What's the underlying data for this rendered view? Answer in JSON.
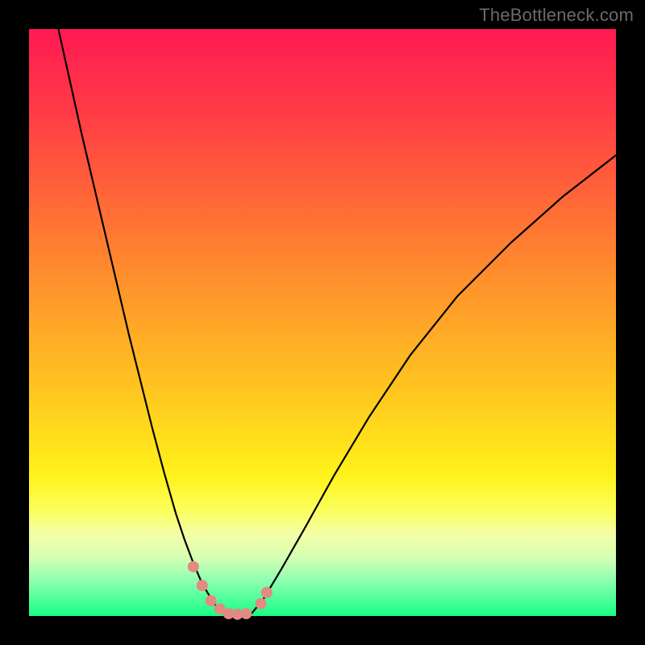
{
  "watermark": "TheBottleneck.com",
  "colors": {
    "gradient_stops": [
      {
        "pct": 0,
        "hex": "#ff1a53"
      },
      {
        "pct": 14,
        "hex": "#ff3b46"
      },
      {
        "pct": 30,
        "hex": "#ff6a36"
      },
      {
        "pct": 46,
        "hex": "#ff9a2a"
      },
      {
        "pct": 62,
        "hex": "#ffc71f"
      },
      {
        "pct": 76,
        "hex": "#fff21a"
      },
      {
        "pct": 82,
        "hex": "#fbff5c"
      },
      {
        "pct": 86,
        "hex": "#f3ffa6"
      },
      {
        "pct": 90,
        "hex": "#d6ffb4"
      },
      {
        "pct": 94,
        "hex": "#8cffb0"
      },
      {
        "pct": 100,
        "hex": "#17ff85"
      }
    ],
    "curve_stroke": "#000000",
    "marker_fill": "#e38a82",
    "frame_bg": "#000000"
  },
  "chart_data": {
    "type": "line",
    "title": "",
    "xlabel": "",
    "ylabel": "",
    "xlim": [
      0,
      100
    ],
    "ylim": [
      0,
      100
    ],
    "grid": false,
    "legend": false,
    "series": [
      {
        "name": "left-branch",
        "x": [
          5,
          7,
          9,
          11,
          13,
          15,
          17,
          19,
          21,
          23,
          25,
          26.5,
          28,
          29.5,
          31,
          32,
          33
        ],
        "y": [
          100,
          91,
          82,
          73.5,
          65,
          56.5,
          48,
          40,
          32,
          24.5,
          17.5,
          13,
          9,
          5.5,
          3,
          1.5,
          0.5
        ]
      },
      {
        "name": "valley-floor",
        "x": [
          33,
          34,
          35,
          36,
          37,
          38
        ],
        "y": [
          0.5,
          0.2,
          0.15,
          0.15,
          0.2,
          0.5
        ]
      },
      {
        "name": "right-branch",
        "x": [
          38,
          40,
          43,
          47,
          52,
          58,
          65,
          73,
          82,
          91,
          100
        ],
        "y": [
          0.5,
          3,
          8,
          15,
          24,
          34,
          44.5,
          54.5,
          63.5,
          71.5,
          78.5
        ]
      }
    ],
    "markers": {
      "name": "salmon-dots",
      "points": [
        {
          "x": 28.0,
          "y": 8.4
        },
        {
          "x": 29.5,
          "y": 5.2
        },
        {
          "x": 31.0,
          "y": 2.6
        },
        {
          "x": 32.5,
          "y": 1.2
        },
        {
          "x": 34.0,
          "y": 0.4
        },
        {
          "x": 35.5,
          "y": 0.3
        },
        {
          "x": 37.0,
          "y": 0.4
        },
        {
          "x": 39.5,
          "y": 2.1
        },
        {
          "x": 40.5,
          "y": 4.0
        }
      ],
      "radius_px": 7
    }
  }
}
